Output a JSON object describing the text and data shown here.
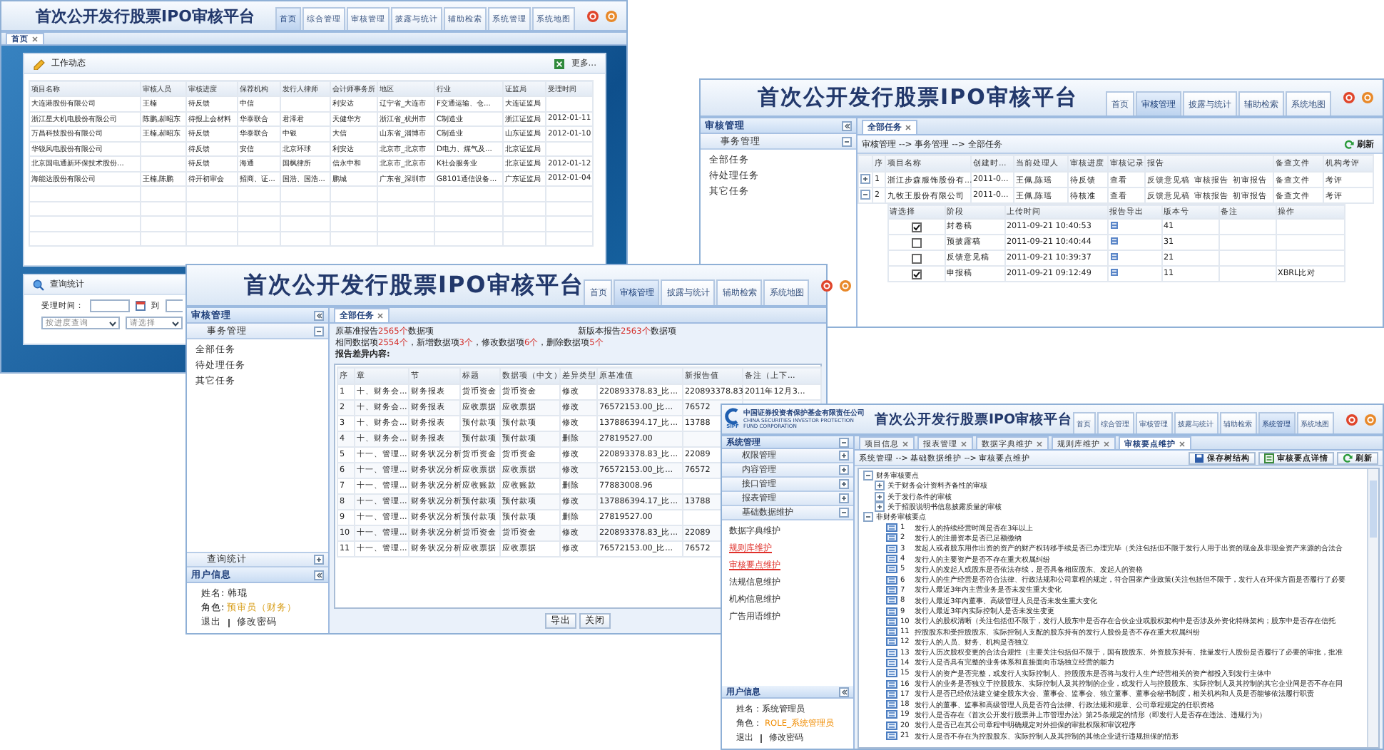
{
  "home_window": {
    "title": "首次公开发行股票IPO审核平台",
    "tabs": [
      {
        "label": "首页",
        "selected": true
      },
      {
        "label": "综合管理",
        "selected": false
      },
      {
        "label": "审核管理",
        "selected": false
      },
      {
        "label": "披露与统计",
        "selected": false
      },
      {
        "label": "辅助检索",
        "selected": false
      },
      {
        "label": "系统管理",
        "selected": false
      },
      {
        "label": "系统地图",
        "selected": false
      }
    ],
    "page_tabs": [
      {
        "label": "首页",
        "selected": true
      }
    ],
    "work_panel": {
      "title": "工作动态",
      "more": "更多...",
      "columns": [
        "项目名称",
        "审核人员",
        "审核进度",
        "保荐机构",
        "发行人律师",
        "会计师事务所",
        "地区",
        "行业",
        "证监局",
        "受理时间"
      ],
      "rows": [
        {
          "name": "大连港股份有限公司",
          "reviewers": "王楠",
          "progress": "待反馈",
          "sponsor": "中信",
          "accountant": "利安达",
          "region": "辽宁省_大连市",
          "industry": "F交通运输、仓...",
          "bureau": "大连证监局"
        },
        {
          "name": "浙江星大机电股份有限公司",
          "reviewers": "陈鹏,郝昭东",
          "progress": "待报上会材料",
          "sponsor": "华泰联合",
          "lawyer": "君泽君",
          "accountant": "天健华方",
          "region": "浙江省_杭州市",
          "industry": "C制造业",
          "bureau": "浙江证监局",
          "date": "2012-01-11"
        },
        {
          "name": "万昌科技股份有限公司",
          "reviewers": "王楠,郝昭东",
          "progress": "待反馈",
          "sponsor": "华泰联合",
          "lawyer": "中银",
          "accountant": "大信",
          "region": "山东省_淄博市",
          "industry": "C制造业",
          "bureau": "山东证监局",
          "date": "2012-01-10"
        },
        {
          "name": "华锐风电股份有限公司",
          "progress": "待反馈",
          "sponsor": "安信",
          "lawyer": "北京环球",
          "accountant": "利安达",
          "region": "北京市_北京市",
          "industry": "D电力、煤气及...",
          "bureau": "北京证监局"
        },
        {
          "name": "北京国电通新环保技术股份...",
          "progress": "待反馈",
          "sponsor": "海通",
          "lawyer": "国枫律所",
          "accountant": "信永中和",
          "region": "北京市_北京市",
          "industry": "K社会服务业",
          "bureau": "北京证监局",
          "date": "2012-01-12"
        },
        {
          "name": "海能达股份有限公司",
          "reviewers": "王楠,陈鹏",
          "progress": "待开初审会",
          "sponsor": "招商、证...",
          "lawyer": "国浩、国浩...",
          "accountant": "鹏城",
          "region": "广东省_深圳市",
          "industry": "G8101通信设备...",
          "bureau": "广东证监局",
          "date": "2012-01-04"
        }
      ]
    },
    "query_panel": {
      "title": "查询统计",
      "date_label": "受理时间：",
      "to_label": "到",
      "selects": [
        "按进度查询",
        "请选择"
      ]
    }
  },
  "task_window": {
    "title": "首次公开发行股票IPO审核平台",
    "tabs": [
      {
        "label": "首页",
        "selected": false
      },
      {
        "label": "审核管理",
        "selected": true
      },
      {
        "label": "披露与统计",
        "selected": false
      },
      {
        "label": "辅助检索",
        "selected": false
      },
      {
        "label": "系统地图",
        "selected": false
      }
    ],
    "sidebar": {
      "title": "审核管理",
      "group": {
        "label": "事务管理",
        "expanded": true
      },
      "items": [
        "全部任务",
        "待处理任务",
        "其它任务"
      ]
    },
    "page_tab": "全部任务",
    "breadcrumb": "审核管理 --> 事务管理 --> 全部任务",
    "refresh": "刷新",
    "columns": [
      "序",
      "项目名称",
      "创建时...",
      "当前处理人",
      "审核进度",
      "审核记录",
      "报告",
      "备查文件",
      "机构考评"
    ],
    "rows": [
      {
        "expanded": false,
        "no": "1",
        "name": "浙江步森服饰股份有...",
        "created": "2011-0...",
        "handler": "王佩,陈瑶",
        "progress": "待反馈",
        "record": "查看",
        "reports": [
          "反馈意见稿",
          "审核报告",
          "初审报告"
        ],
        "files": "备查文件",
        "rating": "考评"
      },
      {
        "expanded": true,
        "no": "2",
        "name": "九牧王股份有限公司",
        "created": "2011-0...",
        "handler": "王佩,陈瑶",
        "progress": "待核准",
        "record": "查看",
        "reports": [
          "反馈意见稿",
          "审核报告",
          "初审报告"
        ],
        "files": "备查文件",
        "rating": "考评"
      }
    ],
    "versions": {
      "columns": [
        "请选择",
        "阶段",
        "上传时间",
        "报告导出",
        "版本号",
        "备注",
        "操作"
      ],
      "rows": [
        {
          "checked": true,
          "stage": "封卷稿",
          "time": "2011-09-21 10:40:53",
          "version": "41"
        },
        {
          "checked": false,
          "stage": "预披露稿",
          "time": "2011-09-21 10:40:44",
          "version": "31"
        },
        {
          "checked": false,
          "stage": "反馈意见稿",
          "time": "2011-09-21 10:39:37",
          "version": "21"
        },
        {
          "checked": true,
          "stage": "申报稿",
          "time": "2011-09-21 09:12:49",
          "version": "11",
          "action": "XBRL比对"
        }
      ]
    }
  },
  "diff_window": {
    "title": "首次公开发行股票IPO审核平台",
    "tabs": [
      {
        "label": "首页",
        "selected": false
      },
      {
        "label": "审核管理",
        "selected": true
      },
      {
        "label": "披露与统计",
        "selected": false
      },
      {
        "label": "辅助检索",
        "selected": false
      },
      {
        "label": "系统地图",
        "selected": false
      }
    ],
    "sidebar": {
      "title": "审核管理",
      "group": {
        "label": "事务管理",
        "expanded": true
      },
      "items": [
        "全部任务",
        "待处理任务",
        "其它任务"
      ],
      "query": {
        "label": "查询统计",
        "expanded": false
      }
    },
    "user_panel": {
      "title": "用户信息",
      "name": "姓名: 韩琨",
      "role_label": "角色:",
      "role": "预审员（财务）",
      "logout": "退出",
      "change_password": "修改密码"
    },
    "page_tab": "全部任务",
    "summary": {
      "base": [
        {
          "text": "原基准报告",
          "highlight": false
        },
        {
          "text": "2565个",
          "highlight": true
        },
        {
          "text": "数据项",
          "highlight": false
        }
      ],
      "new": [
        {
          "text": "新版本报告",
          "highlight": false
        },
        {
          "text": "2563个",
          "highlight": true
        },
        {
          "text": "数据项",
          "highlight": false
        }
      ],
      "counts": [
        {
          "text": "相同数据项",
          "highlight": false
        },
        {
          "text": "2554个",
          "highlight": true
        },
        {
          "text": "，新增数据项",
          "highlight": false
        },
        {
          "text": "3个",
          "highlight": true
        },
        {
          "text": "，修改数据项",
          "highlight": false
        },
        {
          "text": "6个",
          "highlight": true
        },
        {
          "text": "，删除数据项",
          "highlight": false
        },
        {
          "text": "5个",
          "highlight": true
        }
      ],
      "heading": "报告差异内容:"
    },
    "columns": [
      "序",
      "章",
      "节",
      "标题",
      "数据项（中文）",
      "差异类型",
      "原基准值",
      "新报告值",
      "备注（上下..."
    ],
    "rows": [
      {
        "no": "1",
        "chapter": "十、财务会...",
        "section": "财务报表",
        "title": "货币资金",
        "item": "货币资金",
        "type": "修改",
        "old": "220893378.83_比...",
        "new": "220893378.83",
        "note": "2011年12月3..."
      },
      {
        "no": "2",
        "chapter": "十、财务会...",
        "section": "财务报表",
        "title": "应收票据",
        "item": "应收票据",
        "type": "修改",
        "old": "76572153.00_比...",
        "new": "76572"
      },
      {
        "no": "3",
        "chapter": "十、财务会...",
        "section": "财务报表",
        "title": "预付款项",
        "item": "预付款项",
        "type": "修改",
        "old": "137886394.17_比...",
        "new": "13788"
      },
      {
        "no": "4",
        "chapter": "十、财务会...",
        "section": "财务报表",
        "title": "预付款项",
        "item": "预付款项",
        "type": "删除",
        "old": "27819527.00"
      },
      {
        "no": "5",
        "chapter": "十一、管理...",
        "section": "财务状况分析",
        "title": "货币资金",
        "item": "货币资金",
        "type": "修改",
        "old": "220893378.83_比...",
        "new": "22089"
      },
      {
        "no": "6",
        "chapter": "十一、管理...",
        "section": "财务状况分析",
        "title": "应收票据",
        "item": "应收票据",
        "type": "修改",
        "old": "76572153.00_比...",
        "new": "76572"
      },
      {
        "no": "7",
        "chapter": "十一、管理...",
        "section": "财务状况分析",
        "title": "应收账款",
        "item": "应收账款",
        "type": "删除",
        "old": "77883008.96"
      },
      {
        "no": "8",
        "chapter": "十一、管理...",
        "section": "财务状况分析",
        "title": "预付款项",
        "item": "预付款项",
        "type": "修改",
        "old": "137886394.17_比...",
        "new": "13788"
      },
      {
        "no": "9",
        "chapter": "十一、管理...",
        "section": "财务状况分析",
        "title": "预付款项",
        "item": "预付款项",
        "type": "删除",
        "old": "27819527.00"
      },
      {
        "no": "10",
        "chapter": "十一、管理...",
        "section": "财务状况分析",
        "title": "货币资金",
        "item": "货币资金",
        "type": "修改",
        "old": "220893378.83_比...",
        "new": "22089"
      },
      {
        "no": "11",
        "chapter": "十一、管理...",
        "section": "财务状况分析",
        "title": "应收票据",
        "item": "应收票据",
        "type": "修改",
        "old": "76572153.00_比...",
        "new": "76572"
      }
    ],
    "buttons": [
      "导出",
      "关闭"
    ]
  },
  "points_window": {
    "logo": {
      "name": "中国证券投资者保护基金有限责任公司",
      "english": "CHINA SECURITIES INVESTOR PROTECTION FUND CORPORATION",
      "abbr": "SIPF"
    },
    "title": "首次公开发行股票IPO审核平台",
    "tabs": [
      {
        "label": "首页",
        "selected": false
      },
      {
        "label": "综合管理",
        "selected": false
      },
      {
        "label": "审核管理",
        "selected": false
      },
      {
        "label": "披露与统计",
        "selected": false
      },
      {
        "label": "辅助检索",
        "selected": false
      },
      {
        "label": "系统管理",
        "selected": true
      },
      {
        "label": "系统地图",
        "selected": false
      }
    ],
    "sidebar": {
      "title": "系统管理",
      "groups": [
        {
          "label": "权限管理",
          "expanded": false
        },
        {
          "label": "内容管理",
          "expanded": false
        },
        {
          "label": "接口管理",
          "expanded": false
        },
        {
          "label": "报表管理",
          "expanded": false
        },
        {
          "label": "基础数据维护",
          "expanded": true
        }
      ],
      "items": [
        {
          "label": "数据字典维护",
          "highlighted": false
        },
        {
          "label": "规则库维护",
          "highlighted": true
        },
        {
          "label": "审核要点维护",
          "highlighted": true
        },
        {
          "label": "法规信息维护",
          "highlighted": false
        },
        {
          "label": "机构信息维护",
          "highlighted": false
        },
        {
          "label": "广告用语维护",
          "highlighted": false
        }
      ]
    },
    "user_panel": {
      "title": "用户信息",
      "name": "姓名：系统管理员",
      "role_label": "角色：",
      "role": "ROLE_系统管理员",
      "logout": "退出",
      "change_password": "修改密码"
    },
    "page_tabs": [
      {
        "label": "项目信息",
        "selected": false
      },
      {
        "label": "报表管理",
        "selected": false
      },
      {
        "label": "数据字典维护",
        "selected": false
      },
      {
        "label": "规则库维护",
        "selected": false
      },
      {
        "label": "审核要点维护",
        "selected": true
      }
    ],
    "breadcrumb": "系统管理 --> 基础数据维护 --> 审核要点维护",
    "buttons": [
      {
        "kind": "save",
        "label": "保存树结构"
      },
      {
        "kind": "details",
        "label": "审核要点详情"
      },
      {
        "kind": "refresh",
        "label": "刷新"
      }
    ],
    "tree": [
      {
        "label": "财务审核要点",
        "expanded": true,
        "children": [
          {
            "label": "关于财务会计资料齐备性的审核",
            "expanded": false
          },
          {
            "label": "关于发行条件的审核",
            "expanded": false
          },
          {
            "label": "关于招股说明书信息披露质量的审核",
            "expanded": false
          }
        ]
      },
      {
        "label": "非财务审核要点",
        "expanded": true,
        "children": [
          {
            "number": "1",
            "label": "发行人的持续经营时间是否在3年以上"
          },
          {
            "number": "2",
            "label": "发行人的注册资本是否已足额缴纳"
          },
          {
            "number": "3",
            "label": "发起人或者股东用作出资的资产的财产权转移手续是否已办理完毕（关注包括但不限于发行人用于出资的现金及非现金资产来源的合法合"
          },
          {
            "number": "4",
            "label": "发行人的主要资产是否不存在重大权属纠纷"
          },
          {
            "number": "5",
            "label": "发行人的发起人或股东是否依法存续，是否具备相应股东、发起人的资格"
          },
          {
            "number": "6",
            "label": "发行人的生产经营是否符合法律、行政法规和公司章程的规定，符合国家产业政策(关注包括但不限于，发行人在环保方面是否履行了必要"
          },
          {
            "number": "7",
            "label": "发行人最近3年内主营业务是否未发生重大变化"
          },
          {
            "number": "8",
            "label": "发行人最近3年内董事、高级管理人员是否未发生重大变化"
          },
          {
            "number": "9",
            "label": "发行人最近3年内实际控制人是否未发生变更"
          },
          {
            "number": "10",
            "label": "发行人的股权清晰（关注包括但不限于，发行人股东中是否存在合伙企业或股权架构中是否涉及外资化特殊架构；股东中是否存在信托"
          },
          {
            "number": "11",
            "label": "控股股东和受控股股东、实际控制人支配的股东持有的发行人股份是否不存在重大权属纠纷"
          },
          {
            "number": "12",
            "label": "发行人的人员、财务、机构是否独立"
          },
          {
            "number": "13",
            "label": "发行人历次股权变更的合法合规性（主要关注包括但不限于，国有股股东、外资股东持有、批量发行人股份是否履行了必要的审批，批准"
          },
          {
            "number": "14",
            "label": "发行人是否具有完整的业务体系和直接面向市场独立经营的能力"
          },
          {
            "number": "15",
            "label": "发行人的资产是否完整，或发行人实际控制人、控股股东是否将与发行人生产经营相关的资产都投入到发行主体中"
          },
          {
            "number": "16",
            "label": "发行人的业务是否独立于控股股东、实际控制人及其控制的企业，或发行人与控股股东、实际控制人及其控制的其它企业间是否不存在同"
          },
          {
            "number": "17",
            "label": "发行人是否已经依法建立健全股东大会、董事会、监事会、独立董事、董事会秘书制度，相关机构和人员是否能够依法履行职责"
          },
          {
            "number": "18",
            "label": "发行人的董事、监事和高级管理人员是否符合法律、行政法规和规章、公司章程规定的任职资格"
          },
          {
            "number": "19",
            "label": "发行人是否存在《首次公开发行股票并上市管理办法》第25条规定的情形（即发行人是否存在违法、违规行为）"
          },
          {
            "number": "20",
            "label": "发行人是否已在其公司章程中明确规定对外担保的审批权限和审议程序"
          },
          {
            "number": "21",
            "label": "发行人是否不存在为控股股东、实际控制人及其控制的其他企业进行违规担保的情形"
          }
        ]
      }
    ]
  }
}
